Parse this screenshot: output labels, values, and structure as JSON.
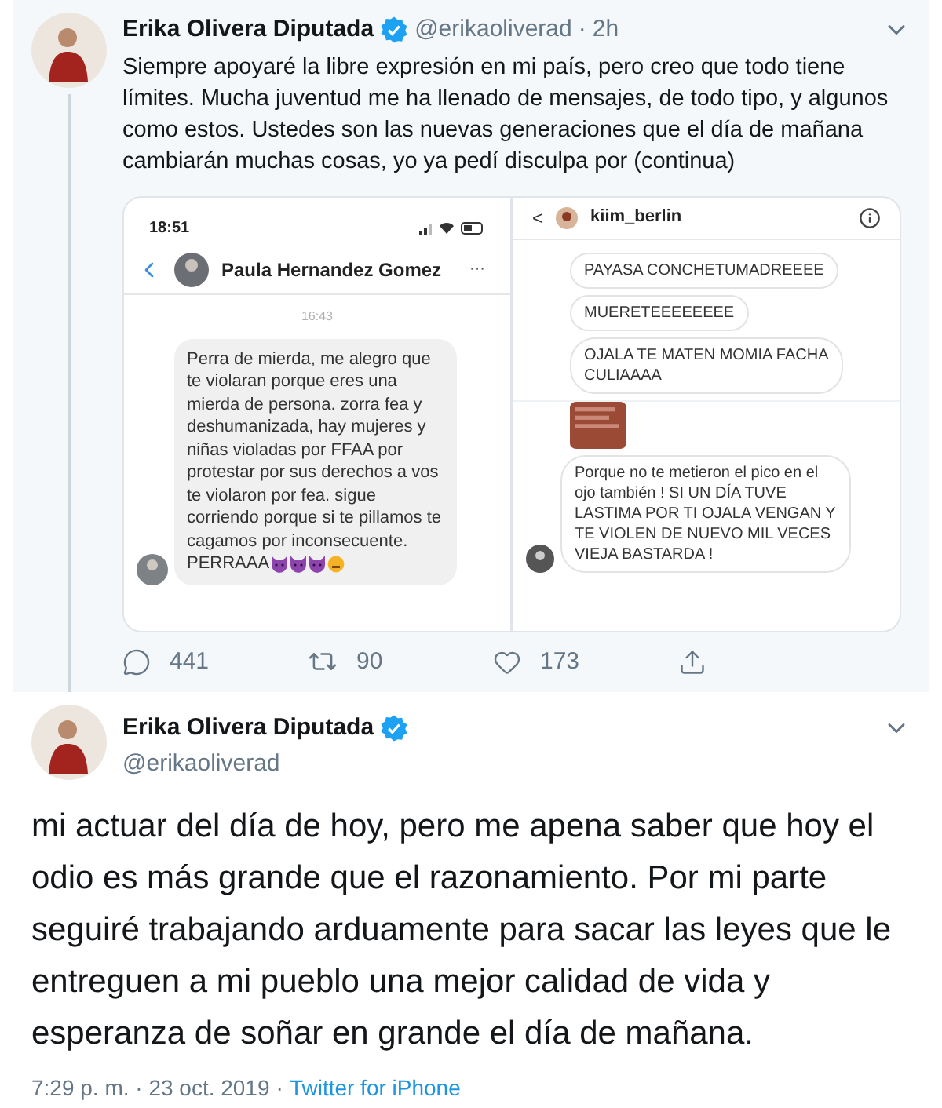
{
  "tweets": [
    {
      "name": "Erika Olivera Diputada",
      "handle": "@erikaoliverad",
      "time_separator": "·",
      "time": "2h",
      "text": "Siempre apoyaré la libre expresión en mi país, pero creo que todo tiene límites. Mucha juventud me ha llenado de mensajes, de todo tipo, y algunos como estos. Ustedes son las nuevas generaciones que el día de mañana cambiarán muchas cosas, yo ya pedí disculpa por (continua)",
      "media": {
        "left": {
          "status_time": "18:51",
          "contact": "Paula Hernandez Gomez",
          "more": "···",
          "timestamp": "16:43",
          "message": "Perra de mierda, me alegro que te violaran porque eres una mierda de persona. zorra fea y deshumanizada, hay  mujeres y niñas violadas por FFAA por protestar por sus derechos a vos te violaron por fea. sigue corriendo porque si te pillamos te cagamos por inconsecuente.",
          "last_line": "PERRAAA"
        },
        "right": {
          "back": "<",
          "contact": "kiim_berlin",
          "messages": [
            "PAYASA CONCHETUMADREEEE",
            "MUERETEEEEEEEE",
            "OJALA TE MATEN MOMIA FACHA CULIAAAA"
          ],
          "reply": "Porque no te metieron el pico en el ojo también ! SI UN DÍA TUVE LASTIMA POR TI OJALA VENGAN Y TE VIOLEN DE NUEVO MIL VECES VIEJA BASTARDA !"
        }
      },
      "actions": [
        {
          "kind": "reply",
          "count": "441"
        },
        {
          "kind": "retweet",
          "count": "90"
        },
        {
          "kind": "like",
          "count": "173"
        },
        {
          "kind": "share"
        }
      ]
    },
    {
      "name": "Erika Olivera Diputada",
      "handle": "@erikaoliverad",
      "text": "mi actuar del día de hoy, pero me apena saber que hoy el odio es más grande que el razonamiento. Por mi parte seguiré trabajando arduamente para sacar las leyes que le entreguen a mi pueblo una mejor calidad de vida y esperanza de soñar en grande el día de mañana.",
      "date": "7:29 p. m. · 23 oct. 2019",
      "separator": "·",
      "source": "Twitter for iPhone"
    }
  ]
}
